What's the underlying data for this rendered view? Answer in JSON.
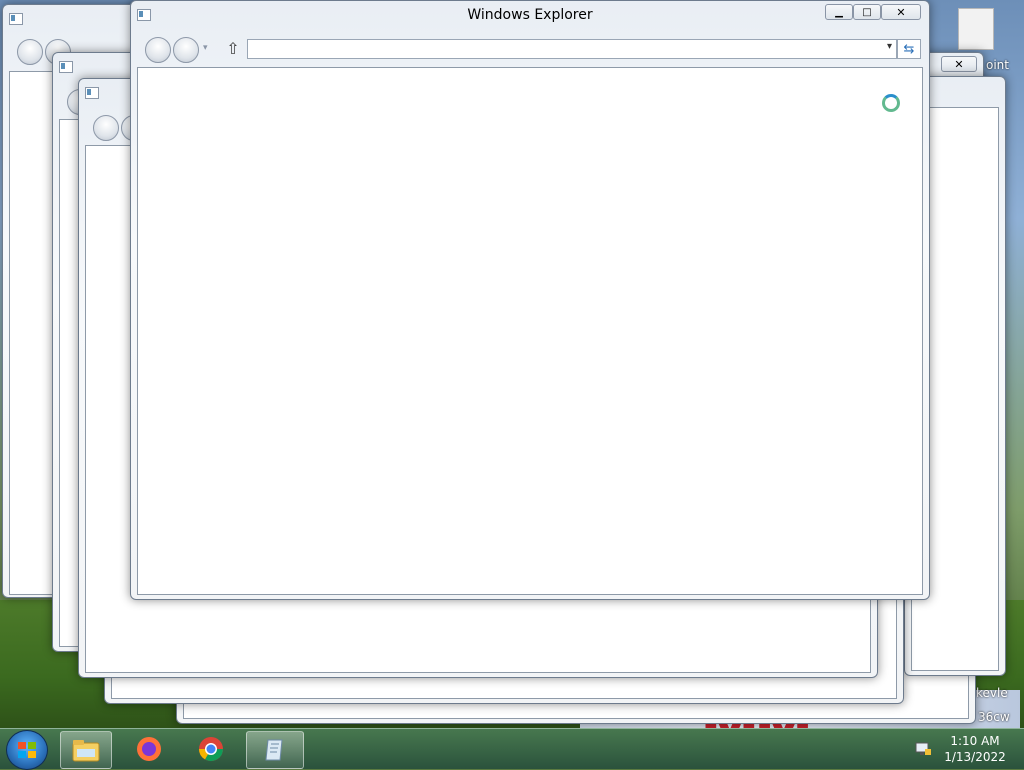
{
  "front_window": {
    "title": "Windows Explorer"
  },
  "desktop": {
    "right_text_1": "kevle",
    "right_text_2": "36cw",
    "right_text_3": "oint"
  },
  "taskbar": {
    "clock_time": "1:10 AM",
    "clock_date": "1/13/2022"
  },
  "colors": {
    "title_text": "#000000",
    "loader_green": "#62b98f",
    "loader_blue": "#2a8fcc"
  }
}
